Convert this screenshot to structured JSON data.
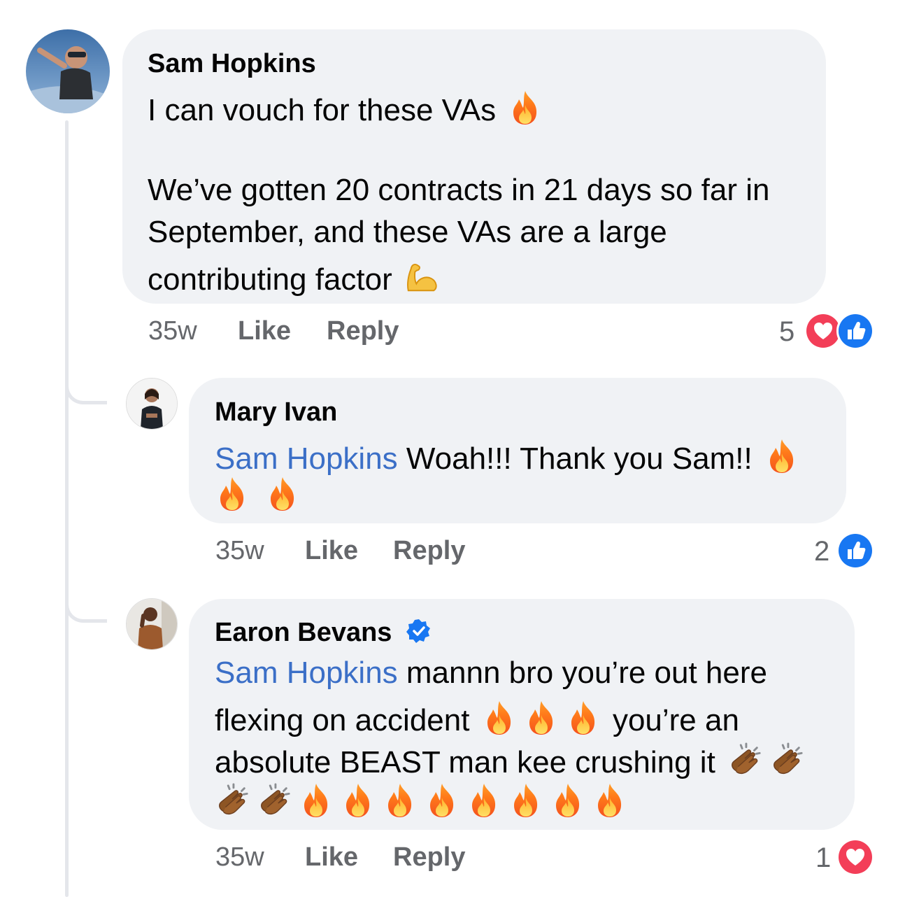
{
  "comments": [
    {
      "author": "Sam Hopkins",
      "lines": [
        "I can vouch for these VAs",
        "We’ve gotten 20 contracts in 21 days so far in",
        "September, and these VAs are a large",
        "contributing factor"
      ],
      "time": "35w",
      "like_label": "Like",
      "reply_label": "Reply",
      "reaction_count": "5"
    },
    {
      "author": "Mary Ivan",
      "mention": "Sam Hopkins",
      "text": " Woah!!! Thank you Sam!!",
      "time": "35w",
      "like_label": "Like",
      "reply_label": "Reply",
      "reaction_count": "2"
    },
    {
      "author": "Earon Bevans",
      "verified": true,
      "mention": "Sam Hopkins",
      "line1": " mannn bro you’re out here",
      "line2a": "flexing on accident",
      "line2b": "you’re an",
      "line3": "absolute BEAST man kee crushing it",
      "time": "35w",
      "like_label": "Like",
      "reply_label": "Reply",
      "reaction_count": "1"
    }
  ],
  "colors": {
    "bubble": "#f0f2f5",
    "mention": "#3b6fc7",
    "meta": "#65676b",
    "like_blue": "#1877f2",
    "love_red": "#f33e58"
  }
}
